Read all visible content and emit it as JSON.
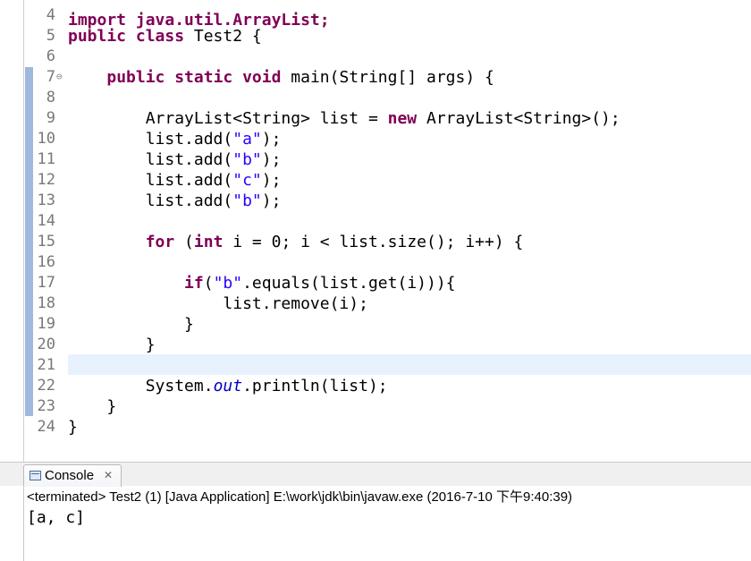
{
  "editor": {
    "top_partial_line": "import java.util.ArrayList;",
    "lines": [
      {
        "n": "4",
        "tokens": []
      },
      {
        "n": "5",
        "tokens": [
          {
            "t": "public class",
            "c": "kw"
          },
          {
            "t": " Test2 {",
            "c": ""
          }
        ]
      },
      {
        "n": "6",
        "tokens": []
      },
      {
        "n": "7",
        "fold": "⊖",
        "tokens": [
          {
            "t": "    ",
            "c": ""
          },
          {
            "t": "public static void",
            "c": "kw"
          },
          {
            "t": " main(String[] args) {",
            "c": ""
          }
        ]
      },
      {
        "n": "8",
        "tokens": []
      },
      {
        "n": "9",
        "tokens": [
          {
            "t": "        ArrayList<String> list = ",
            "c": ""
          },
          {
            "t": "new",
            "c": "kw"
          },
          {
            "t": " ArrayList<String>();",
            "c": ""
          }
        ]
      },
      {
        "n": "10",
        "tokens": [
          {
            "t": "        list.add(",
            "c": ""
          },
          {
            "t": "\"a\"",
            "c": "str"
          },
          {
            "t": ");",
            "c": ""
          }
        ]
      },
      {
        "n": "11",
        "tokens": [
          {
            "t": "        list.add(",
            "c": ""
          },
          {
            "t": "\"b\"",
            "c": "str"
          },
          {
            "t": ");",
            "c": ""
          }
        ]
      },
      {
        "n": "12",
        "tokens": [
          {
            "t": "        list.add(",
            "c": ""
          },
          {
            "t": "\"c\"",
            "c": "str"
          },
          {
            "t": ");",
            "c": ""
          }
        ]
      },
      {
        "n": "13",
        "tokens": [
          {
            "t": "        list.add(",
            "c": ""
          },
          {
            "t": "\"b\"",
            "c": "str"
          },
          {
            "t": ");",
            "c": ""
          }
        ]
      },
      {
        "n": "14",
        "tokens": []
      },
      {
        "n": "15",
        "tokens": [
          {
            "t": "        ",
            "c": ""
          },
          {
            "t": "for",
            "c": "kw"
          },
          {
            "t": " (",
            "c": ""
          },
          {
            "t": "int",
            "c": "kw"
          },
          {
            "t": " i = 0; i < list.size(); i++) {",
            "c": ""
          }
        ]
      },
      {
        "n": "16",
        "tokens": []
      },
      {
        "n": "17",
        "tokens": [
          {
            "t": "            ",
            "c": ""
          },
          {
            "t": "if",
            "c": "kw"
          },
          {
            "t": "(",
            "c": ""
          },
          {
            "t": "\"b\"",
            "c": "str"
          },
          {
            "t": ".equals(list.get(i))){",
            "c": ""
          }
        ]
      },
      {
        "n": "18",
        "tokens": [
          {
            "t": "                list.remove(i);",
            "c": ""
          }
        ]
      },
      {
        "n": "19",
        "tokens": [
          {
            "t": "            }",
            "c": ""
          }
        ]
      },
      {
        "n": "20",
        "tokens": [
          {
            "t": "        }",
            "c": ""
          }
        ]
      },
      {
        "n": "21",
        "tokens": []
      },
      {
        "n": "22",
        "tokens": [
          {
            "t": "        System.",
            "c": ""
          },
          {
            "t": "out",
            "c": "fld"
          },
          {
            "t": ".println(list);",
            "c": ""
          }
        ]
      },
      {
        "n": "23",
        "tokens": [
          {
            "t": "    }",
            "c": ""
          }
        ]
      },
      {
        "n": "24",
        "tokens": [
          {
            "t": "}",
            "c": ""
          }
        ]
      }
    ]
  },
  "console": {
    "tab_label": "Console",
    "tab_close": "✕",
    "status": "<terminated> Test2 (1) [Java Application] E:\\work\\jdk\\bin\\javaw.exe (2016-7-10 下午9:40:39)",
    "output": "[a, c]"
  },
  "colors": {
    "keyword": "#7f0055",
    "string": "#2a00ff",
    "static_field": "#0000c0",
    "current_line": "#e8f2fe",
    "change_bar": "#9fb8dd"
  }
}
